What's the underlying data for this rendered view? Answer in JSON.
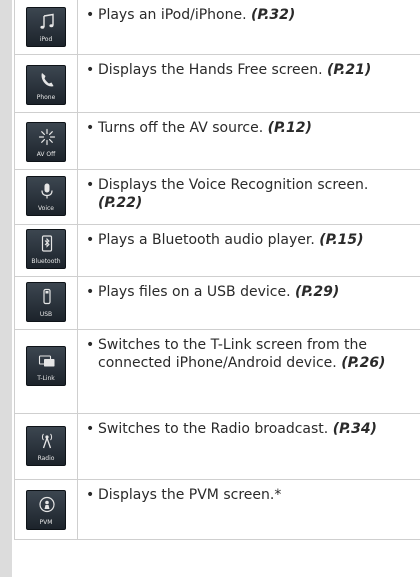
{
  "items": [
    {
      "icon": "music-note-icon",
      "icon_label": "iPod",
      "text": "Plays an iPod/iPhone.",
      "ref": "(P.32)"
    },
    {
      "icon": "phone-icon",
      "icon_label": "Phone",
      "text": "Displays the Hands Free screen.",
      "ref": "(P.21)"
    },
    {
      "icon": "av-off-icon",
      "icon_label": "AV Off",
      "text": "Turns off the AV source.",
      "ref": "(P.12)"
    },
    {
      "icon": "microphone-icon",
      "icon_label": "Voice",
      "text": "Displays the Voice Recognition screen.",
      "ref": "(P.22)"
    },
    {
      "icon": "bluetooth-player-icon",
      "icon_label": "Bluetooth",
      "text": "Plays a Bluetooth audio player.",
      "ref": "(P.15)"
    },
    {
      "icon": "usb-icon",
      "icon_label": "USB",
      "text": "Plays files on a USB device.",
      "ref": "(P.29)"
    },
    {
      "icon": "t-link-icon",
      "icon_label": "T-Link",
      "text": "Switches to the T-Link screen from the connected iPhone/Android device.",
      "ref": "(P.26)"
    },
    {
      "icon": "radio-icon",
      "icon_label": "Radio",
      "text": "Switches to the Radio broadcast.",
      "ref": "(P.34)"
    },
    {
      "icon": "pvm-icon",
      "icon_label": "PVM",
      "text": "Displays the PVM screen.*",
      "ref": ""
    }
  ],
  "bullet_char": "•",
  "colors": {
    "tile_top": "#3c4650",
    "tile_bottom": "#1c232b",
    "sidebar": "#dcdcdc",
    "rule": "#cfcfcf"
  }
}
